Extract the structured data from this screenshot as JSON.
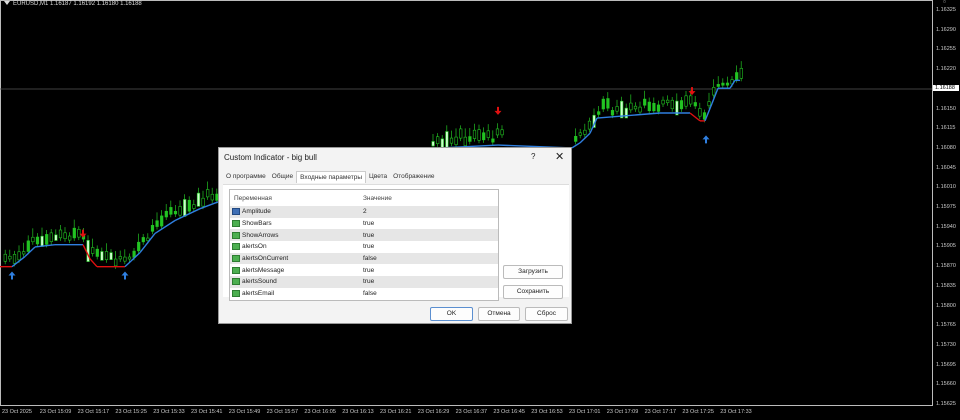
{
  "symbol_info": "EURUSD,M1  1.16187 1.16192 1.16180 1.16188",
  "current_price": "1.16188",
  "price_labels": [
    "1.16325",
    "1.16290",
    "1.16255",
    "1.16220",
    "1.16150",
    "1.16115",
    "1.16080",
    "1.16045",
    "1.16010",
    "1.15975",
    "1.15940",
    "1.15905",
    "1.15870",
    "1.15835",
    "1.15800",
    "1.15765",
    "1.15730",
    "1.15695",
    "1.15660",
    "1.15625"
  ],
  "time_labels": [
    "23 Oct 2025",
    "23 Oct 15:09",
    "23 Oct 15:17",
    "23 Oct 15:25",
    "23 Oct 15:33",
    "23 Oct 15:41",
    "23 Oct 15:49",
    "23 Oct 15:57",
    "23 Oct 16:05",
    "23 Oct 16:13",
    "23 Oct 16:21",
    "23 Oct 16:29",
    "23 Oct 16:37",
    "23 Oct 16:45",
    "23 Oct 16:53",
    "23 Oct 17:01",
    "23 Oct 17:09",
    "23 Oct 17:17",
    "23 Oct 17:25",
    "23 Oct 17:33"
  ],
  "colors": {
    "up_line": "#2f7fe0",
    "down_line": "#e01010",
    "bull": "#22c322",
    "bull_big": "#ccffcc"
  },
  "trend_line": [
    [
      0,
      1.15869,
      "d"
    ],
    [
      12,
      1.15869,
      "u"
    ],
    [
      25,
      1.15887,
      "u"
    ],
    [
      35,
      1.15904,
      "u"
    ],
    [
      55,
      1.15908,
      "u"
    ],
    [
      83,
      1.15908,
      "d"
    ],
    [
      90,
      1.15883,
      "d"
    ],
    [
      97,
      1.15869,
      "d"
    ],
    [
      125,
      1.15869,
      "u"
    ],
    [
      140,
      1.15894,
      "u"
    ],
    [
      155,
      1.15928,
      "u"
    ],
    [
      175,
      1.15951,
      "u"
    ],
    [
      200,
      1.15972,
      "u"
    ],
    [
      218,
      1.15984,
      "u"
    ],
    [
      440,
      1.1608,
      "u"
    ],
    [
      498,
      1.16085,
      "u"
    ],
    [
      572,
      1.1608,
      "u"
    ],
    [
      580,
      1.16089,
      "u"
    ],
    [
      590,
      1.16106,
      "u"
    ],
    [
      597,
      1.16133,
      "u"
    ],
    [
      660,
      1.16142,
      "u"
    ],
    [
      690,
      1.16142,
      "d"
    ],
    [
      700,
      1.16128,
      "d"
    ],
    [
      705,
      1.16128,
      "u"
    ],
    [
      712,
      1.16159,
      "u"
    ],
    [
      718,
      1.16186,
      "u"
    ],
    [
      730,
      1.16186,
      "u"
    ],
    [
      735,
      1.162,
      "u"
    ],
    [
      740,
      1.162,
      "u"
    ]
  ],
  "arrows": [
    {
      "t": 83,
      "p": 1.15926,
      "dir": "down"
    },
    {
      "t": 498,
      "p": 1.16144,
      "dir": "down"
    },
    {
      "t": 692,
      "p": 1.16179,
      "dir": "down"
    },
    {
      "t": 12,
      "p": 1.15855,
      "dir": "up"
    },
    {
      "t": 125,
      "p": 1.15855,
      "dir": "up"
    },
    {
      "t": 706,
      "p": 1.16097,
      "dir": "up"
    }
  ],
  "dialog": {
    "title": "Custom Indicator - big bull",
    "help": "?",
    "close": "✕",
    "tabs": [
      "О программе",
      "Общие",
      "Входные параметры",
      "Цвета",
      "Отображение"
    ],
    "active_tab": 2,
    "columns": [
      "Переменная",
      "Значение"
    ],
    "params": [
      {
        "name": "Amplitude",
        "value": "2",
        "type": "int"
      },
      {
        "name": "ShowBars",
        "value": "true",
        "type": "bool"
      },
      {
        "name": "ShowArrows",
        "value": "true",
        "type": "bool"
      },
      {
        "name": "alertsOn",
        "value": "true",
        "type": "bool"
      },
      {
        "name": "alertsOnCurrent",
        "value": "false",
        "type": "bool"
      },
      {
        "name": "alertsMessage",
        "value": "true",
        "type": "bool"
      },
      {
        "name": "alertsSound",
        "value": "true",
        "type": "bool"
      },
      {
        "name": "alertsEmail",
        "value": "false",
        "type": "bool"
      }
    ],
    "load": "Загрузить",
    "save": "Сохранить",
    "ok": "OK",
    "cancel": "Отмена",
    "reset": "Сброс"
  }
}
